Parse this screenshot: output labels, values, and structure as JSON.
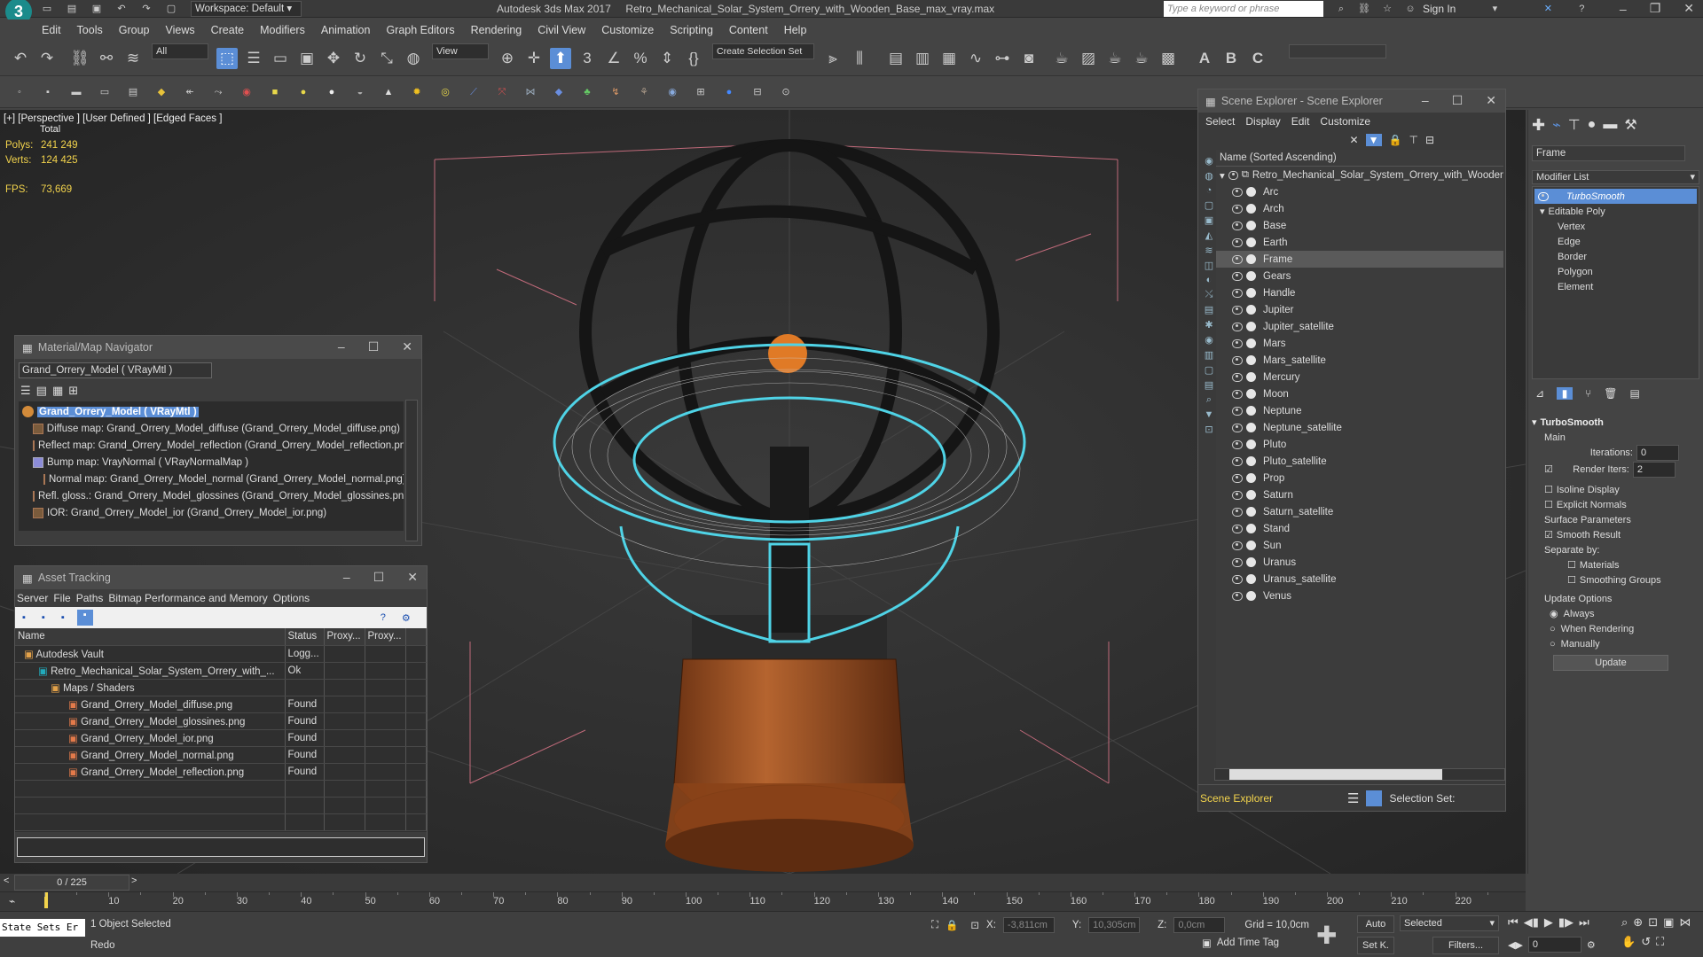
{
  "app": {
    "workspace_label": "Workspace: Default",
    "title": "Autodesk 3ds Max 2017     Retro_Mechanical_Solar_System_Orrery_with_Wooden_Base_max_vray.max",
    "search_placeholder": "Type a keyword or phrase",
    "sign_in": "Sign In"
  },
  "menu": [
    "Edit",
    "Tools",
    "Group",
    "Views",
    "Create",
    "Modifiers",
    "Animation",
    "Graph Editors",
    "Rendering",
    "Civil View",
    "Customize",
    "Scripting",
    "Content",
    "Help"
  ],
  "toolbar": {
    "filter": "All",
    "ref_coord": "View",
    "selection_set": "Create Selection Set"
  },
  "viewport": {
    "label": "[+] [Perspective ] [User Defined ] [Edged Faces ]",
    "stats_total": "Total",
    "polys_label": "Polys:",
    "polys_value": "241 249",
    "verts_label": "Verts:",
    "verts_value": "124 425",
    "fps_label": "FPS:",
    "fps_value": "73,669"
  },
  "material_nav": {
    "title": "Material/Map Navigator",
    "field": "Grand_Orrery_Model  ( VRayMtl )",
    "root": "Grand_Orrery_Model  ( VRayMtl )",
    "items": [
      "Diffuse map: Grand_Orrery_Model_diffuse (Grand_Orrery_Model_diffuse.png)",
      "Reflect map: Grand_Orrery_Model_reflection (Grand_Orrery_Model_reflection.png)",
      "Bump map: VrayNormal  ( VRayNormalMap )",
      "Normal map: Grand_Orrery_Model_normal (Grand_Orrery_Model_normal.png)",
      "Refl. gloss.: Grand_Orrery_Model_glossines (Grand_Orrery_Model_glossines.png)",
      "IOR: Grand_Orrery_Model_ior (Grand_Orrery_Model_ior.png)"
    ]
  },
  "asset_tracking": {
    "title": "Asset Tracking",
    "menu": [
      "Server",
      "File",
      "Paths",
      "Bitmap Performance and Memory",
      "Options"
    ],
    "columns": [
      "Name",
      "Status",
      "Proxy...",
      "Proxy..."
    ],
    "rows": [
      {
        "name": "Autodesk Vault",
        "status": "Logg...",
        "indent": 0
      },
      {
        "name": "Retro_Mechanical_Solar_System_Orrery_with_...",
        "status": "Ok",
        "indent": 1
      },
      {
        "name": "Maps / Shaders",
        "status": "",
        "indent": 2
      },
      {
        "name": "Grand_Orrery_Model_diffuse.png",
        "status": "Found",
        "indent": 3
      },
      {
        "name": "Grand_Orrery_Model_glossines.png",
        "status": "Found",
        "indent": 3
      },
      {
        "name": "Grand_Orrery_Model_ior.png",
        "status": "Found",
        "indent": 3
      },
      {
        "name": "Grand_Orrery_Model_normal.png",
        "status": "Found",
        "indent": 3
      },
      {
        "name": "Grand_Orrery_Model_reflection.png",
        "status": "Found",
        "indent": 3
      }
    ]
  },
  "scene_explorer": {
    "title": "Scene Explorer - Scene Explorer",
    "menu": [
      "Select",
      "Display",
      "Edit",
      "Customize"
    ],
    "header": "Name (Sorted Ascending)",
    "root": "Retro_Mechanical_Solar_System_Orrery_with_Wooden_Base",
    "items": [
      "Arc",
      "Arch",
      "Base",
      "Earth",
      "Frame",
      "Gears",
      "Handle",
      "Jupiter",
      "Jupiter_satellite",
      "Mars",
      "Mars_satellite",
      "Mercury",
      "Moon",
      "Neptune",
      "Neptune_satellite",
      "Pluto",
      "Pluto_satellite",
      "Prop",
      "Saturn",
      "Saturn_satellite",
      "Stand",
      "Sun",
      "Uranus",
      "Uranus_satellite",
      "Venus"
    ],
    "selected": "Frame",
    "footer_label": "Scene Explorer",
    "selection_set_label": "Selection Set:"
  },
  "command_panel": {
    "object_name": "Frame",
    "modifier_list": "Modifier List",
    "stack": [
      "TurboSmooth",
      "Editable Poly",
      "Vertex",
      "Edge",
      "Border",
      "Polygon",
      "Element"
    ],
    "rollout": "TurboSmooth",
    "main": "Main",
    "iterations_label": "Iterations:",
    "iterations": "0",
    "render_iters_label": "Render Iters:",
    "render_iters": "2",
    "isoline": "Isoline Display",
    "explicit": "Explicit Normals",
    "surface": "Surface Parameters",
    "smooth_result": "Smooth Result",
    "separate_by": "Separate by:",
    "materials": "Materials",
    "smoothing_groups": "Smoothing Groups",
    "update_options": "Update Options",
    "always": "Always",
    "when_rendering": "When Rendering",
    "manually": "Manually",
    "update": "Update"
  },
  "timeline": {
    "frame": "0 / 225",
    "ticks": [
      "10",
      "20",
      "30",
      "40",
      "50",
      "60",
      "70",
      "80",
      "90",
      "100",
      "110",
      "120",
      "130",
      "140",
      "150",
      "160",
      "170",
      "180",
      "190",
      "200",
      "210",
      "220"
    ]
  },
  "status": {
    "maxscript": "State Sets Er",
    "selected": "1 Object Selected",
    "prompt": "Redo",
    "x_label": "X:",
    "x": "-3,811cm",
    "y_label": "Y:",
    "y": "10,305cm",
    "z_label": "Z:",
    "z": "0,0cm",
    "grid": "Grid = 10,0cm",
    "add_time_tag": "Add Time Tag",
    "auto": "Auto",
    "set_key": "Set K.",
    "selected_dd": "Selected",
    "filters": "Filters...",
    "frame_field": "0"
  },
  "colors": {
    "accent": "#5b8ed6",
    "wire": "#4fd3e6",
    "wood": "#a0522d"
  }
}
